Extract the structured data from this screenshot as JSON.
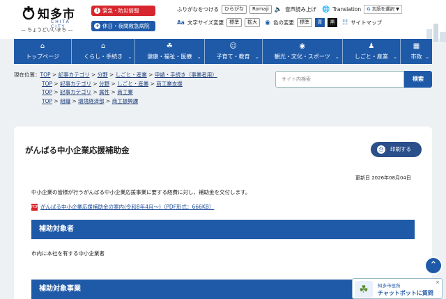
{
  "header": {
    "logo_title": "知多市",
    "logo_en": "CHITA CITY",
    "logo_tag": "— ちょうどいいまち —",
    "emergency_label": "緊急・防災情報",
    "holiday_label": "休日・夜間救急病院"
  },
  "tools": {
    "furigana_label": "ふりがなをつける",
    "hiragana": "ひらがな",
    "romaji": "Romaji",
    "speech": "音声読み上げ",
    "translation": "Translation",
    "google_select": "言語を選択",
    "fontsize_label": "文字サイズ変更",
    "size_standard": "標準",
    "size_large": "拡大",
    "color_label": "色の変更",
    "color_standard": "標準",
    "color_blue": "青",
    "color_black": "黒",
    "sitemap": "サイトマップ",
    "color_blue_hex": "#1f5aa8",
    "color_black_hex": "#111111"
  },
  "nav": [
    {
      "label": "トップページ",
      "icon": "home-icon"
    },
    {
      "label": "くらし・手続き",
      "icon": "house-icon"
    },
    {
      "label": "健康・福祉・医療",
      "icon": "health-icon"
    },
    {
      "label": "子育て・教育",
      "icon": "child-icon"
    },
    {
      "label": "観光・文化・スポーツ",
      "icon": "camera-icon"
    },
    {
      "label": "しごと・産業",
      "icon": "person-icon"
    },
    {
      "label": "市政",
      "icon": "building-icon"
    }
  ],
  "breadcrumb": {
    "current_label": "現在位置：",
    "rows": [
      [
        "TOP",
        "記事カテゴリ",
        "分野",
        "しごと・産業",
        "申請・手続き（事業者用）"
      ],
      [
        "TOP",
        "記事カテゴリ",
        "分野",
        "しごと・産業",
        "商工業支援"
      ],
      [
        "TOP",
        "記事カテゴリ",
        "属性",
        "商工業"
      ],
      [
        "TOP",
        "組織",
        "環境経済部",
        "商工振興課"
      ]
    ]
  },
  "search": {
    "placeholder": "サイト内検索",
    "button": "検索"
  },
  "article": {
    "title": "がんばる中小企業応援補助金",
    "print_label": "印刷する",
    "updated": "更新日 2026年08月04日",
    "description": "中小企業の皆様が行うがんばる中小企業応援事業に要する経費に対し、補助金を交付します。",
    "pdf_link": "がんばる中小企業応援補助金の案内(令和8年4月～)（PDF形式：666KB）",
    "pdf_icon_text": "PDF",
    "section1_title": "補助対象者",
    "section1_text": "市内に本社を有する中小企業者",
    "section2_title": "補助対象事業"
  },
  "chat": {
    "small": "知多市役所",
    "main": "チャットボットに質問"
  }
}
